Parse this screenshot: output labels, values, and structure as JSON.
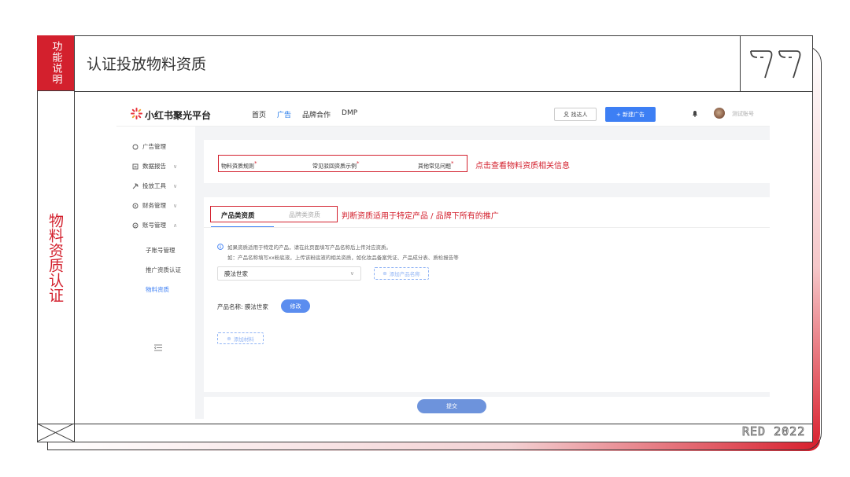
{
  "slide": {
    "tag": "功能说明",
    "title": "认证投放物料资质",
    "section_label": "物料资质认证",
    "brand_mark": "RED 2022"
  },
  "app": {
    "logo_text": "小红书聚光平台",
    "nav": [
      "首页",
      "广告",
      "品牌合作",
      "DMP"
    ],
    "nav_active": "广告",
    "find_button": "找达人",
    "new_ad_button": "+ 新建广告",
    "account": "测试账号"
  },
  "sidebar": {
    "items": [
      {
        "label": "广告管理",
        "icon": "circle-icon",
        "expandable": false
      },
      {
        "label": "数据报告",
        "icon": "report-icon",
        "expandable": true,
        "chevron": "∨"
      },
      {
        "label": "投放工具",
        "icon": "tool-icon",
        "expandable": true,
        "chevron": "∨"
      },
      {
        "label": "财务管理",
        "icon": "finance-icon",
        "expandable": true,
        "chevron": "∨"
      },
      {
        "label": "账号管理",
        "icon": "account-icon",
        "expandable": true,
        "chevron": "∧"
      }
    ],
    "sub_items": [
      "子账号管理",
      "推广资质认证",
      "物料资质"
    ],
    "active_sub": "物料资质"
  },
  "links_card": {
    "links": [
      "物料资质规则",
      "常见驳回资质示例",
      "其他常见问题"
    ],
    "required_mark": "*",
    "annotation": "点击查看物料资质相关信息"
  },
  "qualification_card": {
    "tabs": [
      "产品类资质",
      "品牌类资质"
    ],
    "active_tab": "产品类资质",
    "annotation": "判断资质适用于特定产品 / 品牌下所有的推广",
    "info_line1": "如果资质适用于特定的产品，请在此页面填写产品名称后上传对应资质。",
    "info_line2": "如：产品名称填写xx粉底液，上传该粉底液的相关资质，如化妆品备案凭证、产品成分表、质检报告等",
    "select_value": "膜法世家",
    "add_product_button": "添加产品名称",
    "product_name_label": "产品名称: 膜法世家",
    "edit_button": "修改",
    "add_material_button": "添加材料"
  },
  "submit_button": "提交",
  "colors": {
    "brand_red": "#d3202d",
    "primary_blue": "#3d7ff4"
  }
}
